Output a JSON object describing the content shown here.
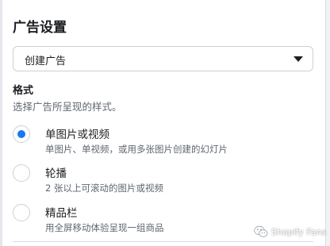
{
  "panel": {
    "title": "广告设置",
    "ad_setup_select": {
      "value": "创建广告"
    },
    "format": {
      "heading": "格式",
      "description": "选择广告所呈现的样式。",
      "options": [
        {
          "label": "单图片或视频",
          "description": "单图片、单视频，或用多张图片创建的幻灯片",
          "selected": true
        },
        {
          "label": "轮播",
          "description": "2 张以上可滚动的图片或视频",
          "selected": false
        },
        {
          "label": "精品栏",
          "description": "用全屏移动体验呈现一组商品",
          "selected": false
        }
      ]
    }
  },
  "watermark": {
    "text": "Shopify Fans"
  },
  "colors": {
    "accent": "#1877f2",
    "text_primary": "#1c1e21",
    "text_secondary": "#606770",
    "border": "#ccd0d5"
  },
  "icons": {
    "select_caret": "caret-down-icon",
    "watermark_logo": "wechat-icon"
  }
}
